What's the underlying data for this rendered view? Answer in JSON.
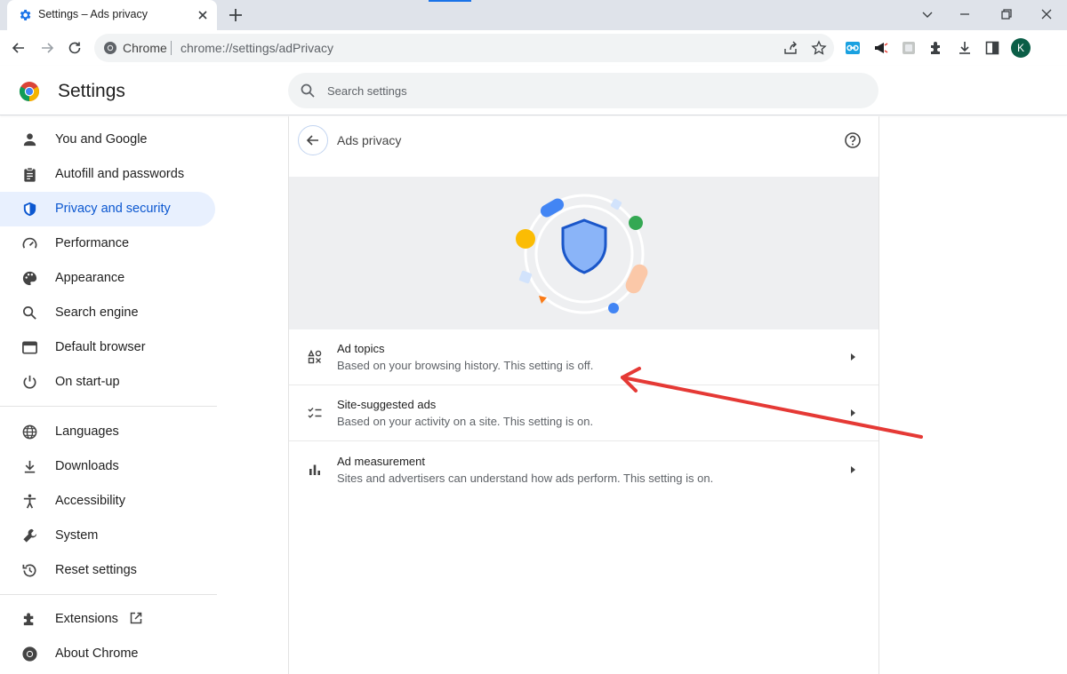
{
  "browser": {
    "tab_title": "Settings – Ads privacy",
    "omnibox_label": "Chrome",
    "url": "chrome://settings/adPrivacy",
    "profile_initial": "K"
  },
  "header": {
    "title": "Settings",
    "search_placeholder": "Search settings"
  },
  "sidebar": {
    "items": [
      {
        "label": "You and Google",
        "icon": "person-icon"
      },
      {
        "label": "Autofill and passwords",
        "icon": "clipboard-icon"
      },
      {
        "label": "Privacy and security",
        "icon": "shield-icon",
        "active": true
      },
      {
        "label": "Performance",
        "icon": "speedometer-icon"
      },
      {
        "label": "Appearance",
        "icon": "palette-icon"
      },
      {
        "label": "Search engine",
        "icon": "search-icon"
      },
      {
        "label": "Default browser",
        "icon": "browser-window-icon"
      },
      {
        "label": "On start-up",
        "icon": "power-icon"
      },
      {
        "label": "Languages",
        "icon": "globe-icon"
      },
      {
        "label": "Downloads",
        "icon": "download-icon"
      },
      {
        "label": "Accessibility",
        "icon": "accessibility-icon"
      },
      {
        "label": "System",
        "icon": "wrench-icon"
      },
      {
        "label": "Reset settings",
        "icon": "reset-history-icon"
      },
      {
        "label": "Extensions",
        "icon": "puzzle-icon"
      },
      {
        "label": "About Chrome",
        "icon": "chrome-icon"
      }
    ]
  },
  "main": {
    "heading": "Ads privacy",
    "rows": [
      {
        "title": "Ad topics",
        "subtitle": "Based on your browsing history. This setting is off.",
        "icon": "topics-icon"
      },
      {
        "title": "Site-suggested ads",
        "subtitle": "Based on your activity on a site. This setting is on.",
        "icon": "checklist-icon"
      },
      {
        "title": "Ad measurement",
        "subtitle": "Sites and advertisers can understand how ads perform. This setting is on.",
        "icon": "bar-chart-icon"
      }
    ]
  },
  "colors": {
    "accent": "#0b57d0",
    "active_nav_bg": "#e8f0fe",
    "annotation_arrow": "#e53935"
  }
}
